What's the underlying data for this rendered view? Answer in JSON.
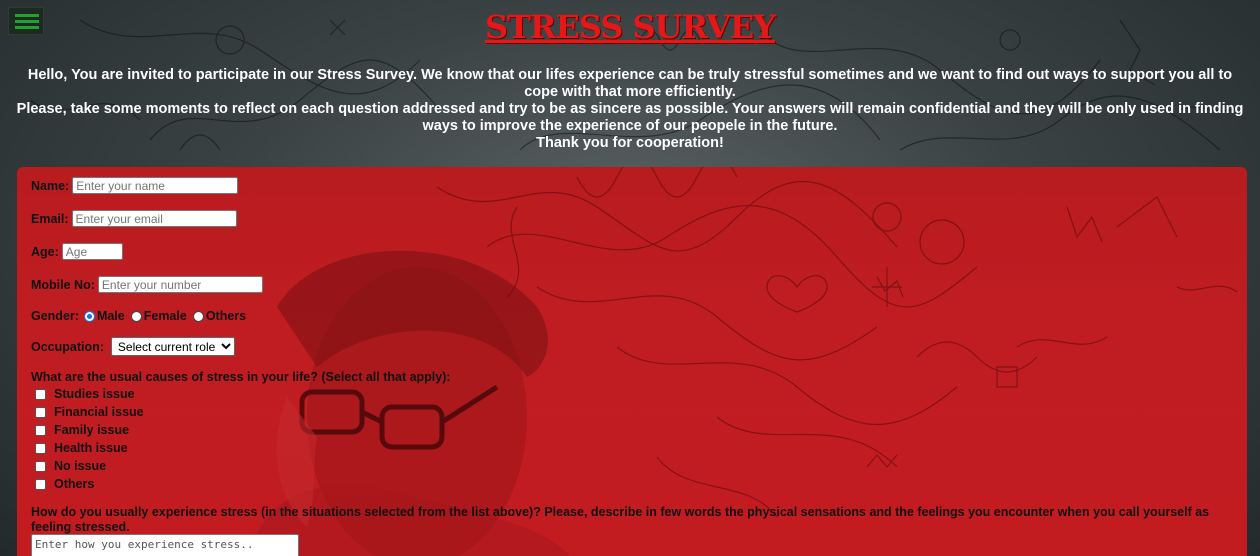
{
  "page": {
    "title": "STRESS SURVEY",
    "intro_lines": [
      "Hello, You are invited to participate in our Stress Survey. We know that our lifes experience can be truly stressful sometimes and we want to find out ways to support you all to cope with that more efficiently.",
      "Please, take some moments to reflect on each question addressed and try to be as sincere as possible. Your answers will remain confidential and they will be only used in finding ways to improve the experience of our peopele in the future.",
      "Thank you for cooperation!"
    ]
  },
  "menu": {
    "icon": "hamburger-menu-icon",
    "color": "#1fa22f"
  },
  "form": {
    "name": {
      "label": "Name:",
      "placeholder": "Enter your name",
      "value": ""
    },
    "email": {
      "label": "Email:",
      "placeholder": "Enter your email",
      "value": ""
    },
    "age": {
      "label": "Age:",
      "placeholder": "Age",
      "value": ""
    },
    "mobile": {
      "label": "Mobile No:",
      "placeholder": "Enter your number",
      "value": ""
    },
    "gender": {
      "label": "Gender:",
      "options": [
        "Male",
        "Female",
        "Others"
      ],
      "selected": "Male"
    },
    "occupation": {
      "label": "Occupation:",
      "selected": "Select current role"
    },
    "causes": {
      "question": "What are the usual causes of stress in your life? (Select all that apply):",
      "options": [
        "Studies issue",
        "Financial issue",
        "Family issue",
        "Health issue",
        "No issue",
        "Others"
      ]
    },
    "experience": {
      "question": "How do you usually experience stress (in the situations selected from the list above)? Please, describe in few words the physical sensations and the feelings you encounter when you call yourself as feeling stressed.",
      "placeholder": "Enter how you experience stress.."
    }
  },
  "colors": {
    "title_red": "#e41818",
    "panel_red": "#c01d22",
    "radio_blue": "#1a73e8"
  }
}
